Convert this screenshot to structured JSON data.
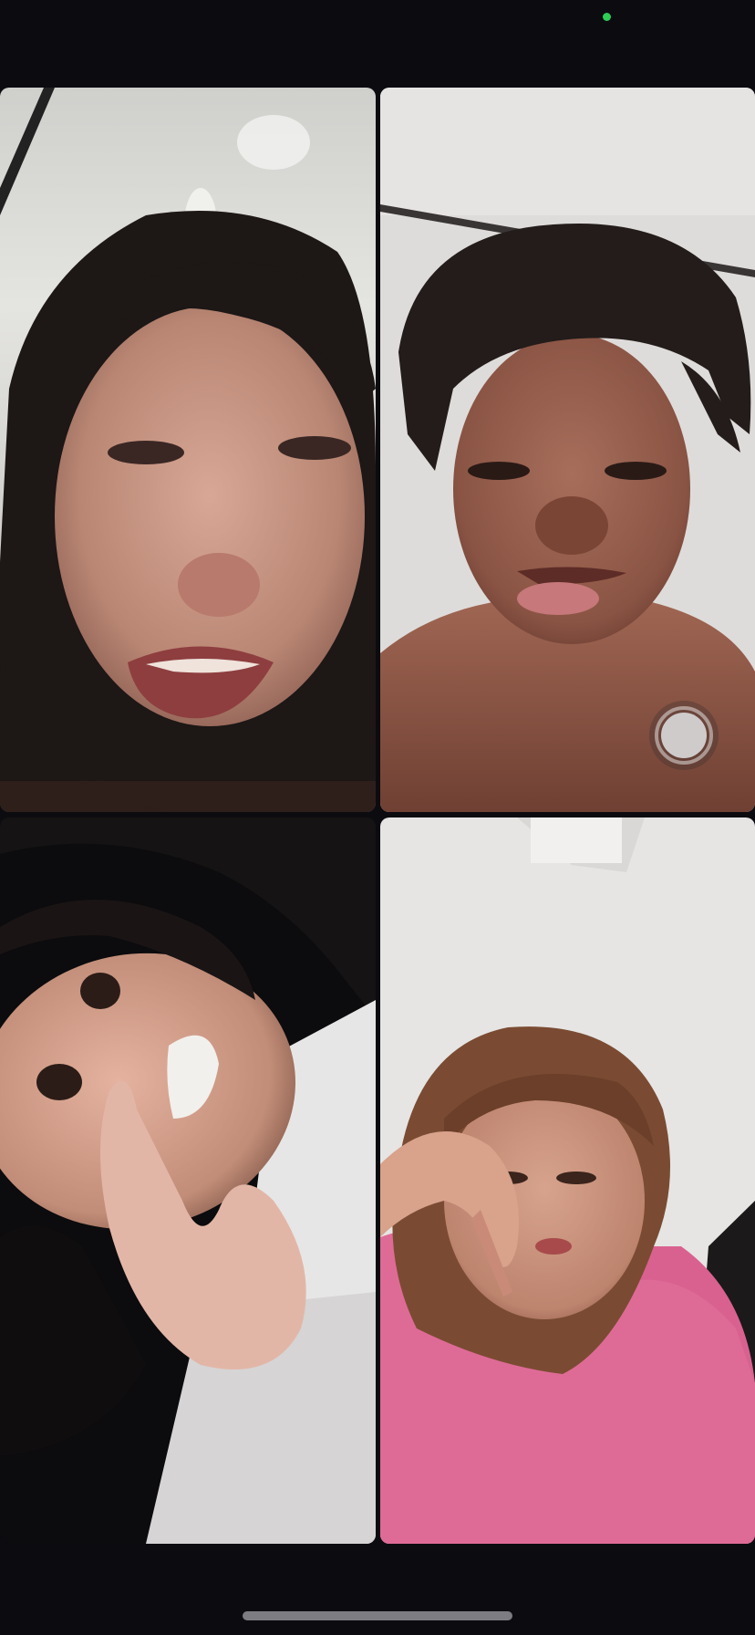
{
  "app": {
    "screen": "group-video-call",
    "background_color": "#0c0b10"
  },
  "status_bar": {
    "indicator_color": "#2ecc56",
    "indicator_icon": "camera-in-use-dot-icon"
  },
  "participants": [
    {
      "icon": "participant-video-feed"
    },
    {
      "icon": "participant-video-feed"
    },
    {
      "icon": "participant-video-feed"
    },
    {
      "icon": "participant-video-feed"
    }
  ],
  "controls": {
    "capture_icon": "capture-button-icon"
  },
  "home_indicator": {
    "color": "#7d7c82"
  }
}
